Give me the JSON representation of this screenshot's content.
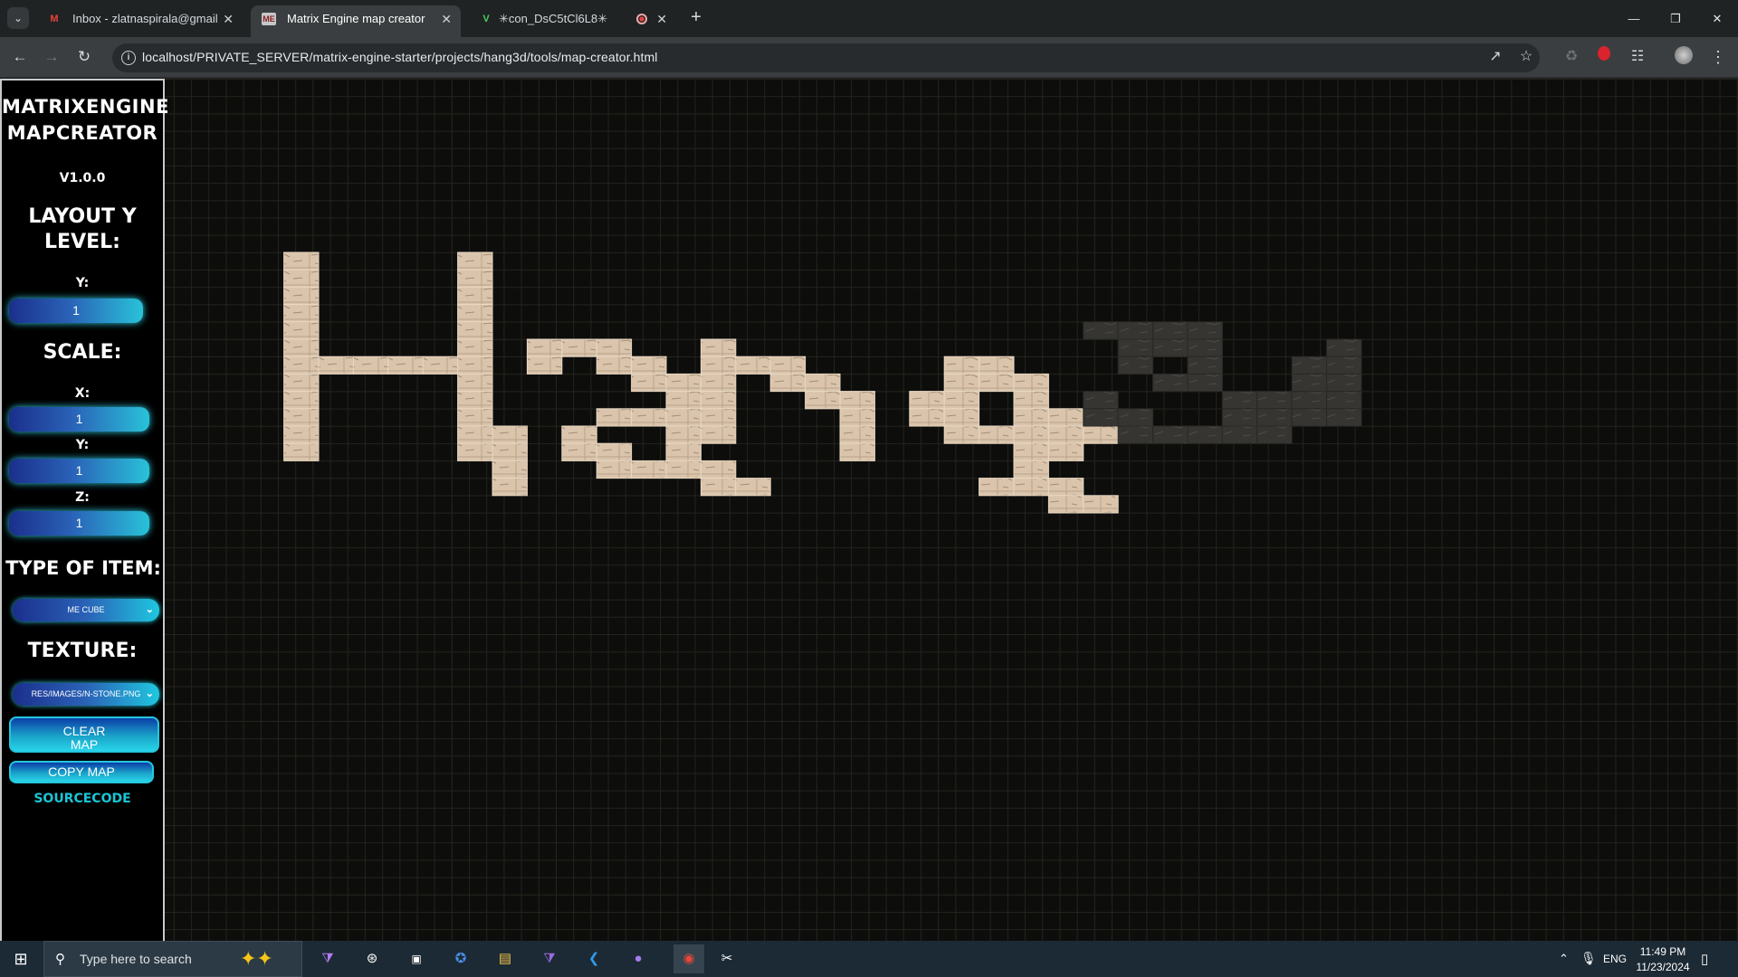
{
  "browser": {
    "tabs": [
      {
        "title": "Inbox - zlatnaspirala@gmail.com",
        "icon": "gmail-icon",
        "active": false
      },
      {
        "title": "Matrix Engine map creator",
        "icon": "matrix-engine-icon",
        "active": true
      },
      {
        "title": "✳con_DsC5tCl6L8✳",
        "icon": "v-logo-icon",
        "active": false
      },
      {
        "title": "",
        "icon": "record-icon",
        "active": false
      }
    ],
    "url": "localhost/PRIVATE_SERVER/matrix-engine-starter/projects/hang3d/tools/map-creator.html"
  },
  "panel": {
    "app_title_line1": "MatrixEngine",
    "app_title_line2": "MapCreator",
    "version": "v1.0.0",
    "layout_heading": "Layout Y level:",
    "y_label": "Y:",
    "y_level_value": "1",
    "scale_heading": "Scale:",
    "scale": {
      "x_label": "X:",
      "x_value": "1",
      "y_label": "Y:",
      "y_value": "1",
      "z_label": "Z:",
      "z_value": "1"
    },
    "type_heading": "Type of item:",
    "type_selected": "ME CUBE",
    "texture_heading": "Texture:",
    "texture_selected": "RES/IMAGES/N-STONE.PNG",
    "clear_map_label": "CLEAR MAP",
    "copy_map_label": "COPY MAP",
    "sourcecode_label": "sourcecode"
  },
  "map": {
    "word": "Hang3d",
    "colors": {
      "stone": "#dac4ab",
      "dark": "#363532",
      "grid": "#24241c",
      "background": "#0d0d0c"
    }
  },
  "taskbar": {
    "search_placeholder": "Type here to search",
    "language": "ENG",
    "time": "11:49 PM",
    "date": "11/23/2024",
    "apps": [
      "visual-studio-icon",
      "unity-icon",
      "terminal-icon",
      "chrome-remote-icon",
      "file-explorer-icon",
      "visual-studio-2-icon",
      "vscode-icon",
      "github-icon",
      "chrome-icon",
      "snipping-icon"
    ]
  }
}
